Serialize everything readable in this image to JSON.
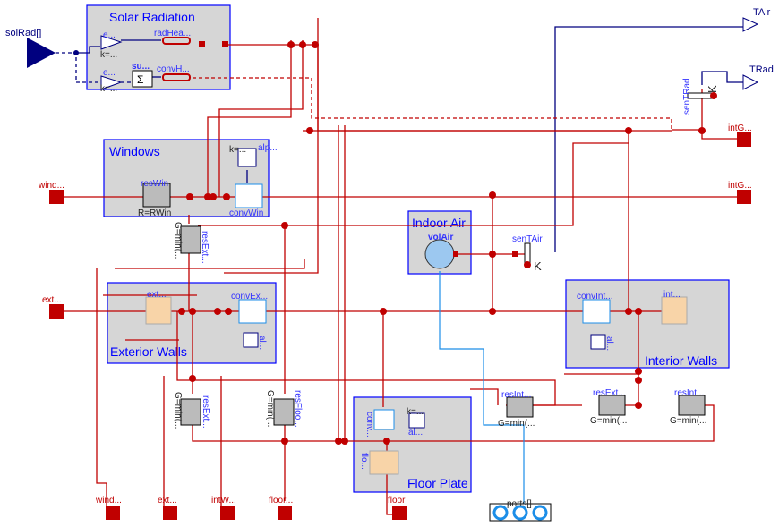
{
  "inputs": {
    "solRad": "solRad[]"
  },
  "outputs": {
    "TAir": "TAir",
    "TRad": "TRad"
  },
  "groups": {
    "solar": "Solar Radiation",
    "windows": "Windows",
    "exterior_walls": "Exterior Walls",
    "indoor_air": "Indoor Air",
    "interior_walls": "Interior Walls",
    "floor_plate": "Floor Plate"
  },
  "components": {
    "gain1": "e...",
    "gain1_k": "k=...",
    "gain2": "e...",
    "gain2_k": "k=...",
    "sum": "su...",
    "sum_symbol": "Σ",
    "radHeat": "radHea...",
    "convHeat": "convH...",
    "resWin": "resWin",
    "resWin_param": "R=RWin",
    "convWin": "convWin",
    "convWin_const": "alp...",
    "convWin_k": "k=...",
    "resExtWin": "resExt...",
    "resExtWin_param": "G=min(...",
    "extWall": "ext...",
    "convExtWall": "convEx...",
    "convExt_const": "al...",
    "volAir": "volAir",
    "senTAir": "senTAir",
    "senTAir_unit": "K",
    "senTRad": "senTRad",
    "senTRad_unit": "K",
    "convIntWall": "convInt...",
    "convInt_const": "al...",
    "intWall": "int...",
    "resExtLow": "resExt...",
    "resExtLow_param": "G=min(...",
    "resFloor": "resFloo...",
    "resFloor_param": "G=min(...",
    "resInt1": "resInt...",
    "resInt1_param": "G=min(...",
    "resExtInt": "resExt...",
    "resExtInt_param": "G=min(...",
    "resInt2": "resInt...",
    "resInt2_param": "G=min(...",
    "convFloor": "conv...",
    "convFloor_const": "al...",
    "convFloor_k": "k=...",
    "floor": "flo..."
  },
  "ports": {
    "window_left": "wind...",
    "ext_left": "ext...",
    "intGainsRad": "intG...",
    "intGainsConv": "intG...",
    "window_bottom": "wind...",
    "ext_bottom": "ext...",
    "intWall_bottom": "intW...",
    "floor_bottom": "floor...",
    "floor": "floor",
    "fluid_ports": "ports[]"
  },
  "colors": {
    "heat": "#c00000",
    "signal": "#00007f",
    "fluid": "#1c8ee8",
    "group_border": "#0000ff",
    "group_fill": "#d6d6d6"
  }
}
